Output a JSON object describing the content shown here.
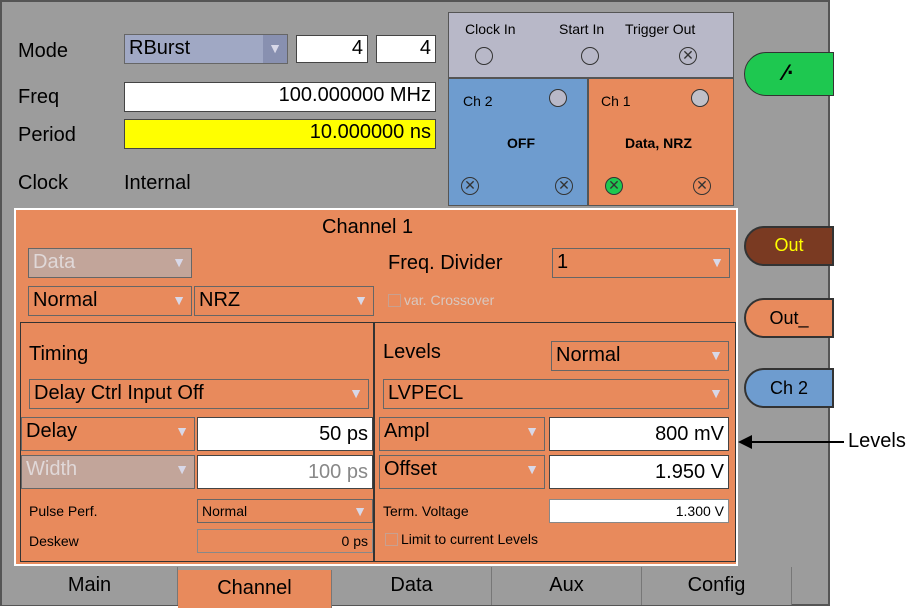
{
  "header": {
    "mode_label": "Mode",
    "mode_value": "RBurst",
    "mode_num1": "4",
    "mode_num2": "4",
    "freq_label": "Freq",
    "freq_value": "100.000000 MHz",
    "period_label": "Period",
    "period_value": "10.000000 ns",
    "clock_label": "Clock",
    "clock_value": "Internal"
  },
  "connectors": {
    "clock_in": "Clock In",
    "start_in": "Start In",
    "trigger_out": "Trigger Out",
    "ch2_label": "Ch 2",
    "ch2_status": "OFF",
    "ch1_label": "Ch 1",
    "ch1_status": "Data, NRZ"
  },
  "channel": {
    "title": "Channel 1",
    "data_select": "Data",
    "freq_divider_label": "Freq. Divider",
    "freq_divider_value": "1",
    "polarity_select": "Normal",
    "format_select": "NRZ",
    "var_crossover_label": "var. Crossover"
  },
  "timing": {
    "title": "Timing",
    "delay_ctrl": "Delay Ctrl Input Off",
    "delay_label": "Delay",
    "delay_value": "50 ps",
    "width_label": "Width",
    "width_value": "100 ps",
    "pulse_perf_label": "Pulse Perf.",
    "pulse_perf_value": "Normal",
    "deskew_label": "Deskew",
    "deskew_value": "0 ps"
  },
  "levels": {
    "title": "Levels",
    "mode_value": "Normal",
    "standard_value": "LVPECL",
    "ampl_label": "Ampl",
    "ampl_value": "800 mV",
    "offset_label": "Offset",
    "offset_value": "1.950 V",
    "term_voltage_label": "Term. Voltage",
    "term_voltage_value": "1.300 V",
    "limit_label": "Limit to current Levels"
  },
  "side_buttons": {
    "out": "Out",
    "out_bar": "Out_",
    "ch2": "Ch 2"
  },
  "tabs": [
    "Main",
    "Channel",
    "Data",
    "Aux",
    "Config"
  ],
  "annotation": {
    "levels_callout": "Levels"
  },
  "colors": {
    "panel_orange": "#e88a5c",
    "highlight_yellow": "#ffff00",
    "ch2_blue": "#6e9ccf",
    "out_brown": "#7a3a22",
    "green_button": "#1ec850"
  }
}
